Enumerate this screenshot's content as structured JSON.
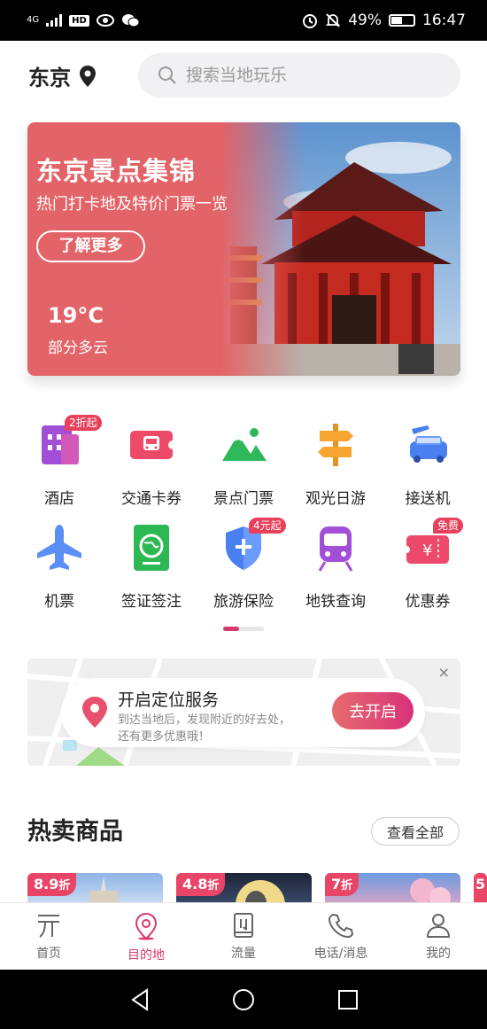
{
  "status_bar": {
    "network": "4G",
    "hd": "HD",
    "battery": "49%",
    "battery_level": 0.49,
    "time": "16:47"
  },
  "header": {
    "city": "东京",
    "search_placeholder": "搜索当地玩乐"
  },
  "banner": {
    "title": "东京景点集锦",
    "subtitle": "热门打卡地及特价门票一览",
    "button": "了解更多",
    "temperature": "19°C",
    "weather": "部分多云"
  },
  "categories": [
    {
      "label": "酒店",
      "icon": "hotel-icon",
      "badge": "2折起"
    },
    {
      "label": "交通卡券",
      "icon": "transit-ticket-icon",
      "badge": ""
    },
    {
      "label": "景点门票",
      "icon": "mountain-icon",
      "badge": ""
    },
    {
      "label": "观光日游",
      "icon": "signpost-icon",
      "badge": ""
    },
    {
      "label": "接送机",
      "icon": "airport-transfer-icon",
      "badge": ""
    },
    {
      "label": "机票",
      "icon": "airplane-icon",
      "badge": ""
    },
    {
      "label": "签证签注",
      "icon": "passport-icon",
      "badge": ""
    },
    {
      "label": "旅游保险",
      "icon": "insurance-shield-icon",
      "badge": "4元起"
    },
    {
      "label": "地铁查询",
      "icon": "subway-icon",
      "badge": ""
    },
    {
      "label": "优惠券",
      "icon": "coupon-icon",
      "badge": "免费"
    }
  ],
  "location_card": {
    "title": "开启定位服务",
    "desc_line1": "到达当地后，发现附近的好去处，",
    "desc_line2": "还有更多优惠哦！",
    "button": "去开启",
    "close": "×"
  },
  "hot": {
    "title": "热卖商品",
    "more": "查看全部",
    "products": [
      {
        "discount": "8.9",
        "unit": "折"
      },
      {
        "discount": "4.8",
        "unit": "折"
      },
      {
        "discount": "7",
        "unit": "折"
      },
      {
        "discount": "5",
        "unit": ""
      }
    ]
  },
  "tabs": [
    {
      "label": "首页",
      "icon": "home-icon"
    },
    {
      "label": "目的地",
      "icon": "location-pin-icon",
      "active": true
    },
    {
      "label": "流量",
      "icon": "data-card-icon"
    },
    {
      "label": "电话/消息",
      "icon": "phone-icon"
    },
    {
      "label": "我的",
      "icon": "profile-icon"
    }
  ],
  "colors": {
    "accent": "#d9386a",
    "banner": "#e36468",
    "badge": "#e8405b"
  }
}
